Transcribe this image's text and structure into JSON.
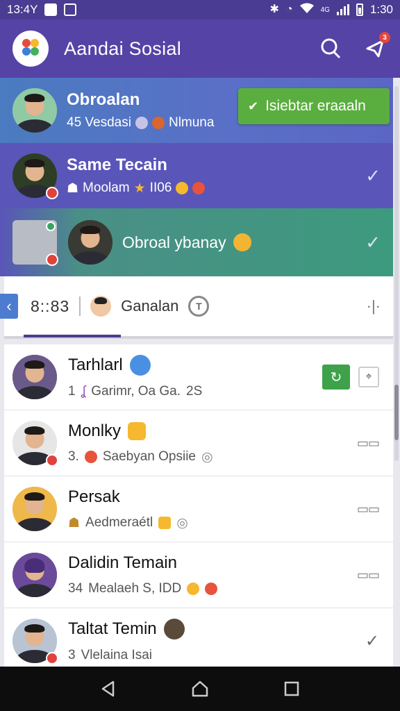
{
  "status_bar": {
    "time_left": "13:4Y",
    "time_right": "1:30",
    "signal_label": "4G",
    "icons": [
      "image-icon",
      "app-icon",
      "bluetooth-icon",
      "alarm-icon",
      "wifi-icon",
      "signal-icon",
      "battery-icon"
    ]
  },
  "app_bar": {
    "title": "Aandai Sosial",
    "notification_count": "3",
    "icons": [
      "app-logo",
      "search-icon",
      "share-icon"
    ]
  },
  "highlighted_chats": [
    {
      "name": "Obroalan",
      "preview": "45 Vesdasi",
      "preview_tail": "Nlmuna",
      "status": "check"
    },
    {
      "name": "Same Tecain",
      "preview": "Moolam",
      "preview_tail": "II06",
      "status": "check"
    },
    {
      "name": "Obroal ybanay",
      "preview": "",
      "status": "check"
    }
  ],
  "send_button": {
    "label": "Isiebtar eraaaln"
  },
  "now_bar": {
    "time": "8::83",
    "contact": "Ganalan",
    "info_icon": "T"
  },
  "chat_list": [
    {
      "name": "Tarhlarl",
      "preview": "1",
      "preview_text": "Garimr, Oa Ga.",
      "preview_tail": "2S",
      "actions": [
        "ok",
        "pin"
      ]
    },
    {
      "name": "Monlky",
      "preview": "3.",
      "preview_text": "Saebyan Opsiie",
      "actions": [
        "ruler"
      ]
    },
    {
      "name": "Persak",
      "preview": "",
      "preview_text": "Aedmeraétl",
      "actions": [
        "ruler"
      ]
    },
    {
      "name": "Dalidin Temain",
      "preview": "34",
      "preview_text": "Mealaeh S, IDD",
      "actions": [
        "ruler"
      ]
    },
    {
      "name": "Taltat Temin",
      "preview": "3",
      "preview_text": "Vlelaina Isai",
      "actions": [
        "check"
      ]
    }
  ],
  "colors": {
    "appbar": "#5543a6",
    "statusbar": "#4a3c92",
    "accent_green": "#5aae3f",
    "highlight_blue": "#5a55b8",
    "highlight_teal": "#3d9a7e",
    "badge_red": "#e0433e"
  },
  "nav_bar": {
    "icons": [
      "back-icon",
      "home-icon",
      "recents-icon"
    ]
  }
}
